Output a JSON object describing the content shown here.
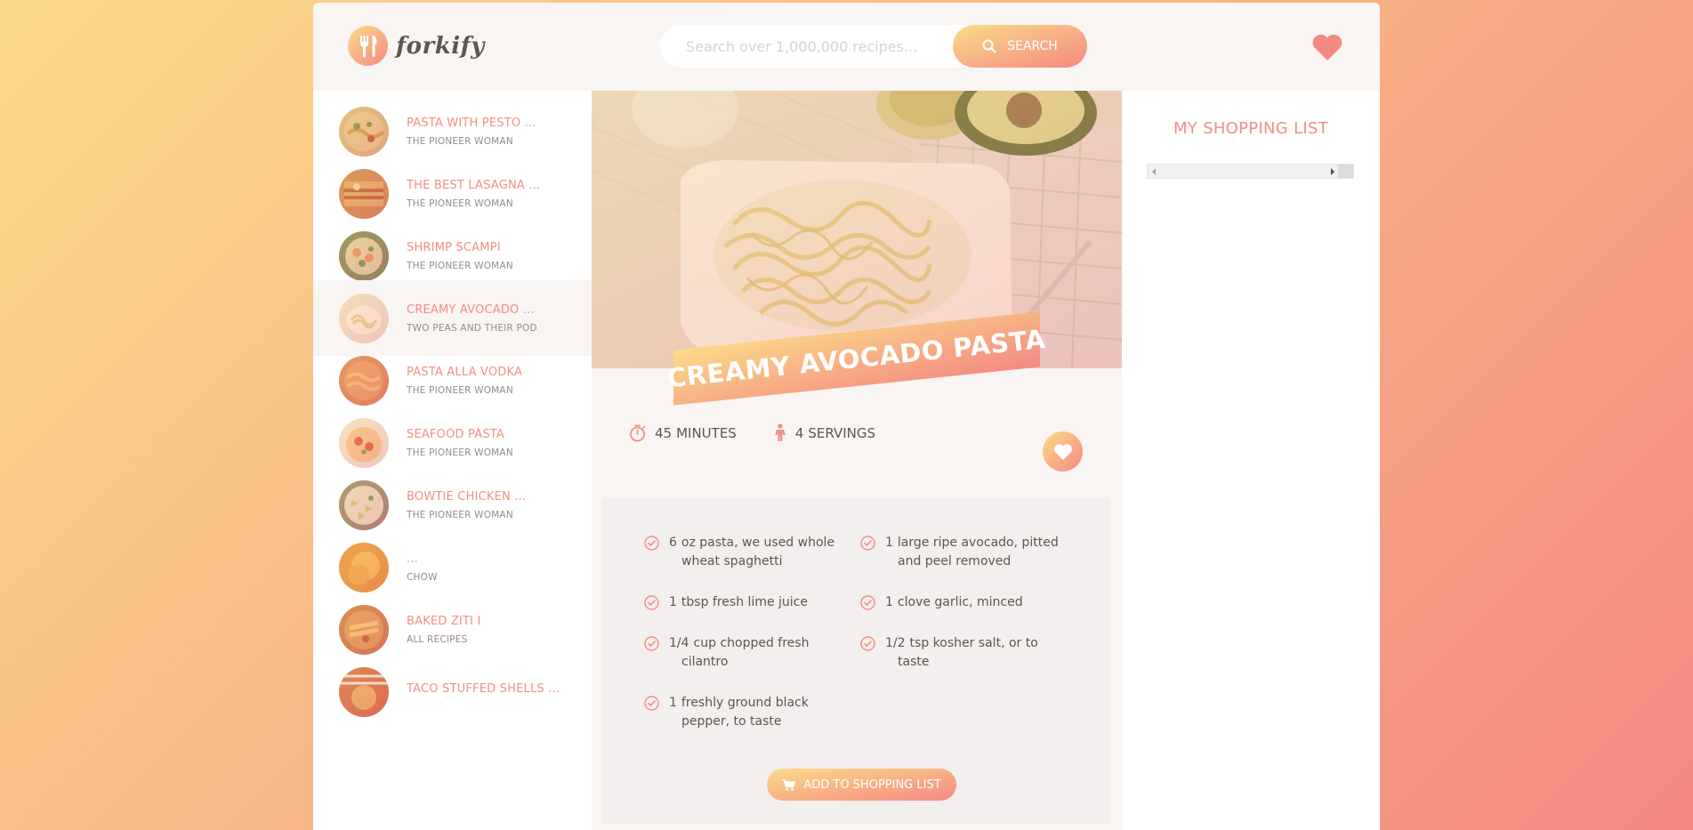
{
  "app": {
    "name": "forkify"
  },
  "search": {
    "placeholder": "Search over 1,000,000 recipes...",
    "button_label": "Search"
  },
  "results": [
    {
      "title": "Pasta with Pesto ...",
      "author": "The Pioneer Woman",
      "image": "pesto-pasta"
    },
    {
      "title": "The Best Lasagna ...",
      "author": "The Pioneer Woman",
      "image": "lasagna"
    },
    {
      "title": "Shrimp Scampi",
      "author": "The Pioneer Woman",
      "image": "shrimp-scampi"
    },
    {
      "title": "Creamy Avocado ...",
      "author": "Two Peas and Their Pod",
      "image": "avocado-pasta",
      "active": true
    },
    {
      "title": "Pasta alla Vodka",
      "author": "The Pioneer Woman",
      "image": "vodka-pasta"
    },
    {
      "title": "Seafood Pasta",
      "author": "The Pioneer Woman",
      "image": "seafood-pasta"
    },
    {
      "title": "Bowtie Chicken ...",
      "author": "The Pioneer Woman",
      "image": "bowtie-chicken"
    },
    {
      "title": "...",
      "author": "Chow",
      "image": "chow-dish"
    },
    {
      "title": "Baked Ziti I",
      "author": "All Recipes",
      "image": "baked-ziti"
    },
    {
      "title": "Taco Stuffed Shells ...",
      "author": "",
      "image": "taco-shells"
    }
  ],
  "recipe": {
    "title": "Creamy Avocado Pasta",
    "time": {
      "value": "45",
      "unit": "minutes"
    },
    "servings": {
      "value": "4",
      "unit": "servings"
    },
    "ingredients": [
      {
        "count": "6",
        "text": "oz pasta, we used whole wheat spaghetti"
      },
      {
        "count": "1",
        "text": "large ripe avocado, pitted and peel removed"
      },
      {
        "count": "1",
        "text": "tbsp fresh lime juice"
      },
      {
        "count": "1",
        "text": "clove garlic, minced"
      },
      {
        "count": "1/4",
        "text": "cup chopped fresh cilantro"
      },
      {
        "count": "1/2",
        "text": "tsp kosher salt, or to taste"
      },
      {
        "count": "1",
        "text": "freshly ground black pepper, to taste"
      }
    ],
    "add_to_list_label": "Add to shopping list"
  },
  "shopping": {
    "title": "My Shopping List"
  },
  "colors": {
    "accent_from": "#fbdb89",
    "accent_to": "#f48982",
    "text": "#615551",
    "title": "#f38e82"
  },
  "icons": {
    "logo": "fork-knife-icon",
    "search": "magnifier-icon",
    "likes": "heart-icon",
    "time": "stopwatch-icon",
    "servings": "person-icon",
    "ingredient": "check-circle-icon",
    "cart": "cart-icon"
  }
}
